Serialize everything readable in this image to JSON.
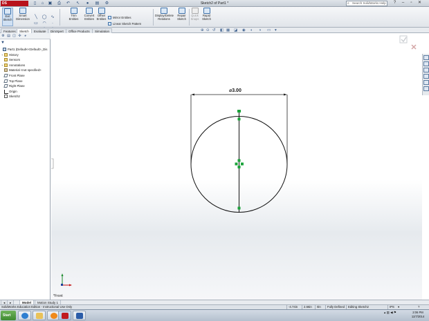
{
  "app": {
    "logo_text": "DS SOLIDWORKS",
    "window_title": "Sketch2 of Part1 *",
    "search_placeholder": "Search SolidWorks Help",
    "brand_color": "#b8121b"
  },
  "ribbon": {
    "exit_sketch": "Exit Sketch",
    "smart_dimension": "Smart Dimension",
    "trim_entities": "Trim Entities",
    "convert_entities": "Convert Entities",
    "offset_entities": "Offset Entities",
    "mirror_entities": "Mirror Entities",
    "linear_sketch_pattern": "Linear Sketch Pattern",
    "move_entities": "Move Entities",
    "display_delete_relations": "Display/Delete Relations",
    "repair_sketch": "Repair Sketch",
    "quick_snaps": "Quick Snaps",
    "rapid_sketch": "Rapid Sketch"
  },
  "tabs": [
    "Features",
    "Sketch",
    "Evaluate",
    "DimXpert",
    "Office Products",
    "Simulation"
  ],
  "active_tab": "Sketch",
  "tree": [
    {
      "label": "Part1  (Default<<Default>_Dis",
      "icon": "part-icon",
      "twisty": ""
    },
    {
      "label": "History",
      "icon": "folder-icon",
      "twisty": "+"
    },
    {
      "label": "Sensors",
      "icon": "sensor-icon",
      "twisty": ""
    },
    {
      "label": "Annotations",
      "icon": "annotations-icon",
      "twisty": "+"
    },
    {
      "label": "Material <not specified>",
      "icon": "material-icon",
      "twisty": ""
    },
    {
      "label": "Front Plane",
      "icon": "plane-icon",
      "twisty": ""
    },
    {
      "label": "Top Plane",
      "icon": "plane-icon",
      "twisty": ""
    },
    {
      "label": "Right Plane",
      "icon": "plane-icon",
      "twisty": ""
    },
    {
      "label": "Origin",
      "icon": "origin-icon",
      "twisty": ""
    },
    {
      "label": "Sketch2",
      "icon": "sketch-icon",
      "twisty": ""
    }
  ],
  "sketch": {
    "dimension_label": "⌀3.00",
    "view_label": "*Front",
    "diameter": 3.0,
    "geometry_color": "#000000",
    "point_color": "#1aa33a"
  },
  "bottom_tabs": [
    "Model",
    "Motion Study 1"
  ],
  "active_bottom_tab": "Model",
  "status": {
    "product": "SolidWorks Education Edition - Instructional Use Only",
    "x": "-4.74in",
    "y": "2.66in",
    "z": "0in",
    "defined": "Fully Defined",
    "editing": "Editing Sketch2",
    "units": "IPS"
  },
  "taskbar": {
    "start_label": "Start",
    "time": "2:06 PM",
    "date": "11/7/2014"
  }
}
